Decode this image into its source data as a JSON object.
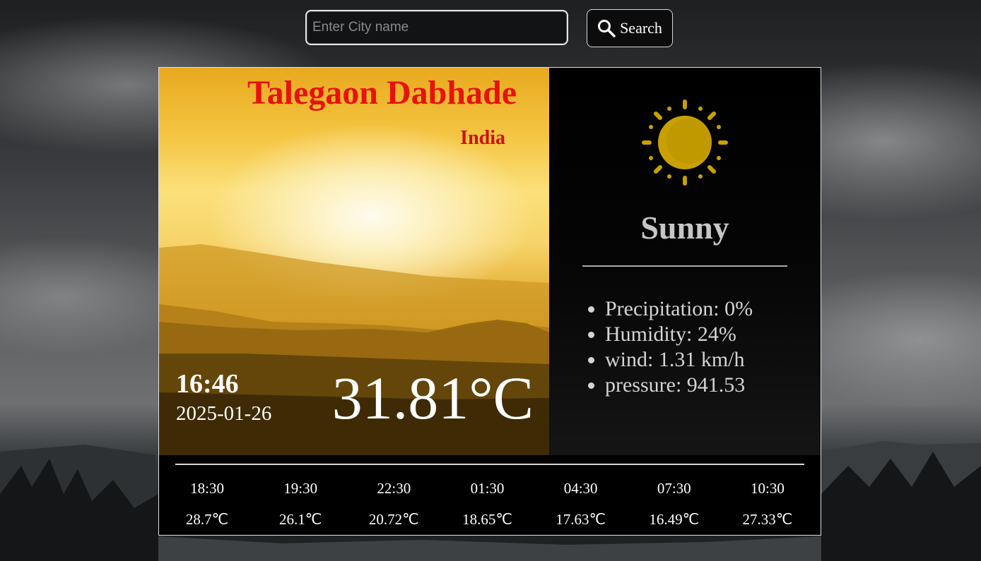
{
  "search": {
    "placeholder": "Enter City name",
    "value": "",
    "button_label": "Search",
    "icon": "search-icon"
  },
  "location": {
    "city": "Talegaon Dabhade",
    "country": "India"
  },
  "current": {
    "time": "16:46",
    "date": "2025-01-26",
    "temperature": "31.81°C",
    "condition": "Sunny",
    "condition_icon": "sun-icon"
  },
  "details": [
    "Precipitation: 0%",
    "Humidity: 24%",
    "wind: 1.31 km/h",
    "pressure: 941.53"
  ],
  "forecast": [
    {
      "time": "18:30",
      "temp": "28.7℃"
    },
    {
      "time": "19:30",
      "temp": "26.1℃"
    },
    {
      "time": "22:30",
      "temp": "20.72℃"
    },
    {
      "time": "01:30",
      "temp": "18.65℃"
    },
    {
      "time": "04:30",
      "temp": "17.63℃"
    },
    {
      "time": "07:30",
      "temp": "16.49℃"
    },
    {
      "time": "10:30",
      "temp": "27.33℃"
    }
  ],
  "colors": {
    "city_text": "#e8120c",
    "sun": "#c9a000",
    "card_border": "#e0e0e0"
  }
}
